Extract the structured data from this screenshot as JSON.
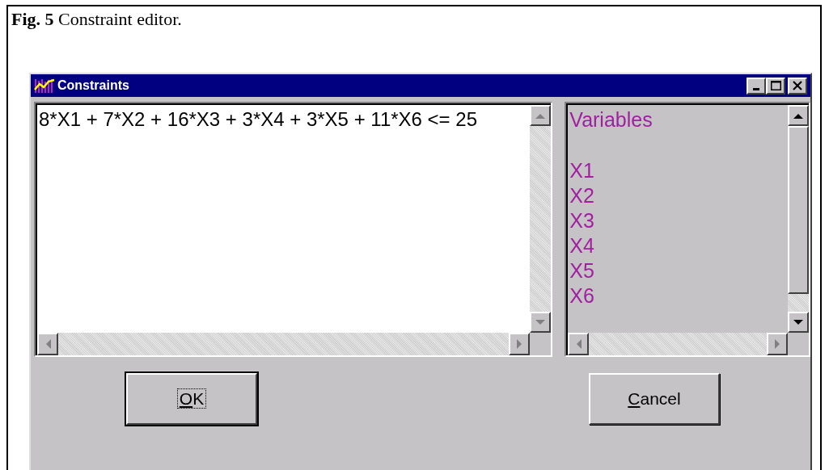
{
  "caption": "**Fig. 5**  Constraint editor.",
  "window": {
    "title": "Constraints",
    "controls": [
      {
        "kind": "minimize"
      },
      {
        "kind": "maximize"
      },
      {
        "kind": "close"
      }
    ]
  },
  "editor": {
    "value": "8*X1 + 7*X2 + 16*X3 + 3*X4 + 3*X5 + 11*X6 <= 25"
  },
  "variables": {
    "header": "Variables",
    "items": [
      "X1",
      "X2",
      "X3",
      "X4",
      "X5",
      "X6"
    ]
  },
  "buttons": [
    {
      "key": "O",
      "rest": "K",
      "default": true,
      "focused": true
    },
    {
      "key": "C",
      "rest": "ancel",
      "default": false,
      "focused": false
    }
  ]
}
